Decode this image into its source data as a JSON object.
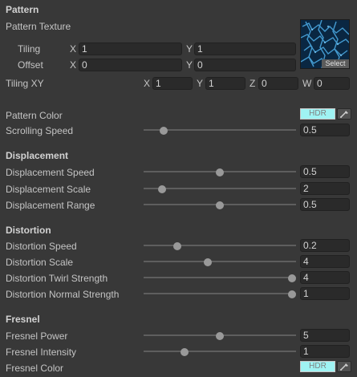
{
  "pattern": {
    "header": "Pattern",
    "texture_label": "Pattern Texture",
    "texture_select": "Select",
    "tiling_label": "Tiling",
    "tiling_x_axis": "X",
    "tiling_x": "1",
    "tiling_y_axis": "Y",
    "tiling_y": "1",
    "offset_label": "Offset",
    "offset_x_axis": "X",
    "offset_x": "0",
    "offset_y_axis": "Y",
    "offset_y": "0",
    "tilingxy_label": "Tiling XY",
    "txy_x_axis": "X",
    "txy_x": "1",
    "txy_y_axis": "Y",
    "txy_y": "1",
    "txy_z_axis": "Z",
    "txy_z": "0",
    "txy_w_axis": "W",
    "txy_w": "0",
    "color_label": "Pattern Color",
    "color_hdr": "HDR",
    "color_hex": "#9ff3f3",
    "scroll_label": "Scrolling Speed",
    "scroll_value": "0.5",
    "scroll_level": 0.13
  },
  "displacement": {
    "header": "Displacement",
    "speed_label": "Displacement Speed",
    "speed_value": "0.5",
    "speed_level": 0.5,
    "scale_label": "Displacement Scale",
    "scale_value": "2",
    "scale_level": 0.12,
    "range_label": "Displacement Range",
    "range_value": "0.5",
    "range_level": 0.5
  },
  "distortion": {
    "header": "Distortion",
    "speed_label": "Distortion Speed",
    "speed_value": "0.2",
    "speed_level": 0.22,
    "scale_label": "Distortion Scale",
    "scale_value": "4",
    "scale_level": 0.42,
    "twirl_label": "Distortion Twirl Strength",
    "twirl_value": "4",
    "twirl_level": 1.0,
    "normal_label": "Distortion Normal Strength",
    "normal_value": "1",
    "normal_level": 1.0
  },
  "fresnel": {
    "header": "Fresnel",
    "power_label": "Fresnel Power",
    "power_value": "5",
    "power_level": 0.5,
    "intensity_label": "Fresnel Intensity",
    "intensity_value": "1",
    "intensity_level": 0.27,
    "color_label": "Fresnel Color",
    "color_hdr": "HDR",
    "color_hex": "#9ff3f3"
  },
  "icons": {
    "picker": "eyedropper-icon",
    "texture": "texture-preview"
  },
  "colors": {
    "background": "#383838",
    "field": "#2a2a2a",
    "slider_knob": "#999999"
  }
}
